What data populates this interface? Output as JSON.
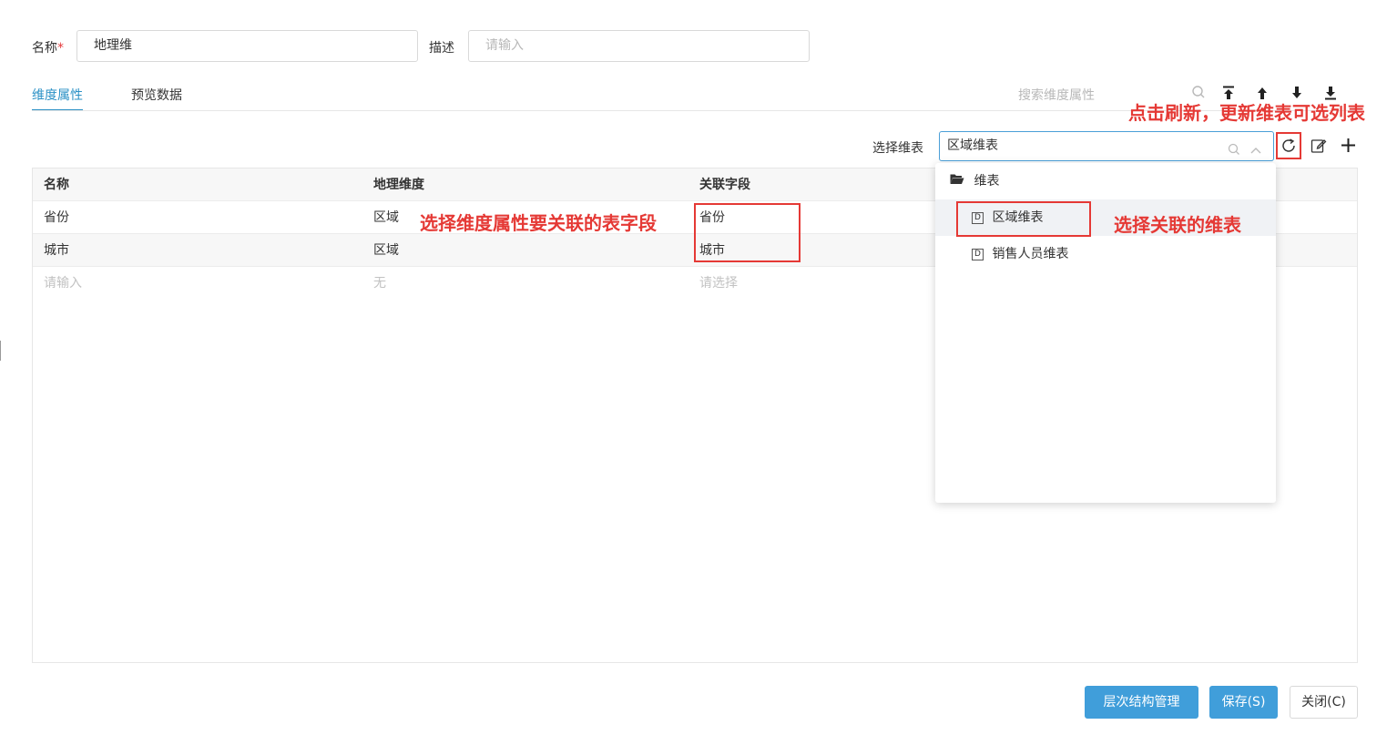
{
  "form": {
    "name_label": "名称",
    "required_mark": "*",
    "name_value": "地理维",
    "desc_label": "描述",
    "desc_placeholder": "请输入"
  },
  "tabs": [
    {
      "label": "维度属性",
      "active": true
    },
    {
      "label": "预览数据",
      "active": false
    }
  ],
  "toolbar": {
    "search_placeholder": "搜索维度属性",
    "icons": [
      "search-icon",
      "move-top-icon",
      "move-up-icon",
      "move-down-icon",
      "move-bottom-icon"
    ]
  },
  "selector": {
    "label": "选择维表",
    "value": "区域维表",
    "icons": [
      "refresh-icon",
      "edit-icon",
      "add-icon"
    ]
  },
  "table": {
    "columns": [
      "名称",
      "地理维度",
      "关联字段"
    ],
    "rows": [
      {
        "name": "省份",
        "geo": "区域",
        "field": "省份"
      },
      {
        "name": "城市",
        "geo": "区域",
        "field": "城市"
      }
    ],
    "new_row": {
      "name_placeholder": "请输入",
      "geo_placeholder": "无",
      "field_placeholder": "请选择"
    }
  },
  "dropdown": {
    "folder": "维表",
    "items": [
      {
        "label": "区域维表",
        "icon": "D",
        "selected": true
      },
      {
        "label": "销售人员维表",
        "icon": "D",
        "selected": false
      }
    ]
  },
  "annotations": {
    "refresh_note": "点击刷新，更新维表可选列表",
    "field_note": "选择维度属性要关联的表字段",
    "table_note": "选择关联的维表"
  },
  "buttons": {
    "hierarchy": "层次结构管理",
    "save": "保存(S)",
    "close": "关闭(C)"
  },
  "colors": {
    "accent": "#2b91c6",
    "primary_button": "#409eda",
    "annotation": "#e53935"
  }
}
